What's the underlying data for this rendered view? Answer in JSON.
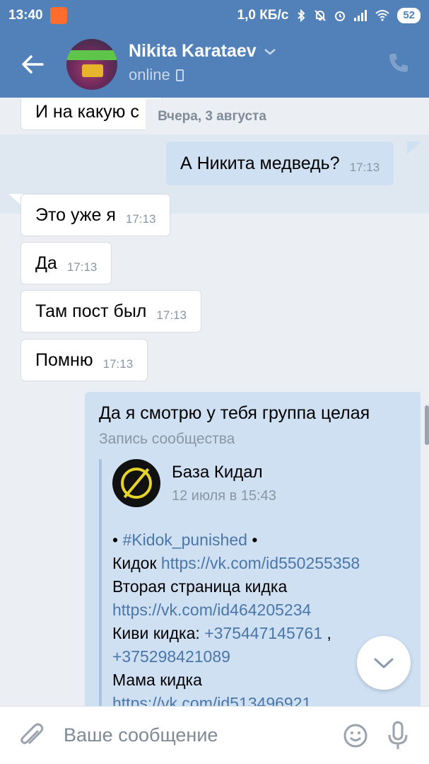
{
  "status_bar": {
    "time": "13:40",
    "net_speed": "1,0 КБ/с",
    "battery": "52"
  },
  "header": {
    "contact_name": "Nikita Karataev",
    "presence": "online",
    "accent": "#5181b8"
  },
  "chat": {
    "partial_message": "И на какую с",
    "date_divider": "Вчера, 3 августа",
    "outgoing": [
      {
        "text": "А Никита медведь?",
        "time": "17:13"
      }
    ],
    "incoming": [
      {
        "text": "Это уже я",
        "time": "17:13"
      },
      {
        "text": "Да",
        "time": "17:13"
      },
      {
        "text": "Там пост был",
        "time": "17:13"
      },
      {
        "text": "Помню",
        "time": "17:13"
      }
    ],
    "post_message": {
      "text": "Да я смотрю у тебя группа целая",
      "label": "Запись сообщества",
      "group_name": "База Кидал",
      "post_date": "12 июля в 15:43",
      "hashtag": "#Kidok_punished",
      "bullet": "•",
      "line_kidok": "Кидок",
      "link1": "https://vk.com/id550255358",
      "line_second_page": "Вторая страница кидка",
      "link2": "https://vk.com/id464205234",
      "line_qiwi": "Киви кидка:",
      "phone1": "+375447145761",
      "comma": ",",
      "phone2": "+375298421089",
      "line_mother": "Мама кидка",
      "link3": "https://vk.com/id513496921"
    }
  },
  "composer": {
    "placeholder": "Ваше сообщение"
  },
  "icons": [
    "back-arrow-icon",
    "chevron-down-icon",
    "phone-icon",
    "attach-icon",
    "emoji-icon",
    "mic-icon",
    "scroll-down-icon"
  ]
}
